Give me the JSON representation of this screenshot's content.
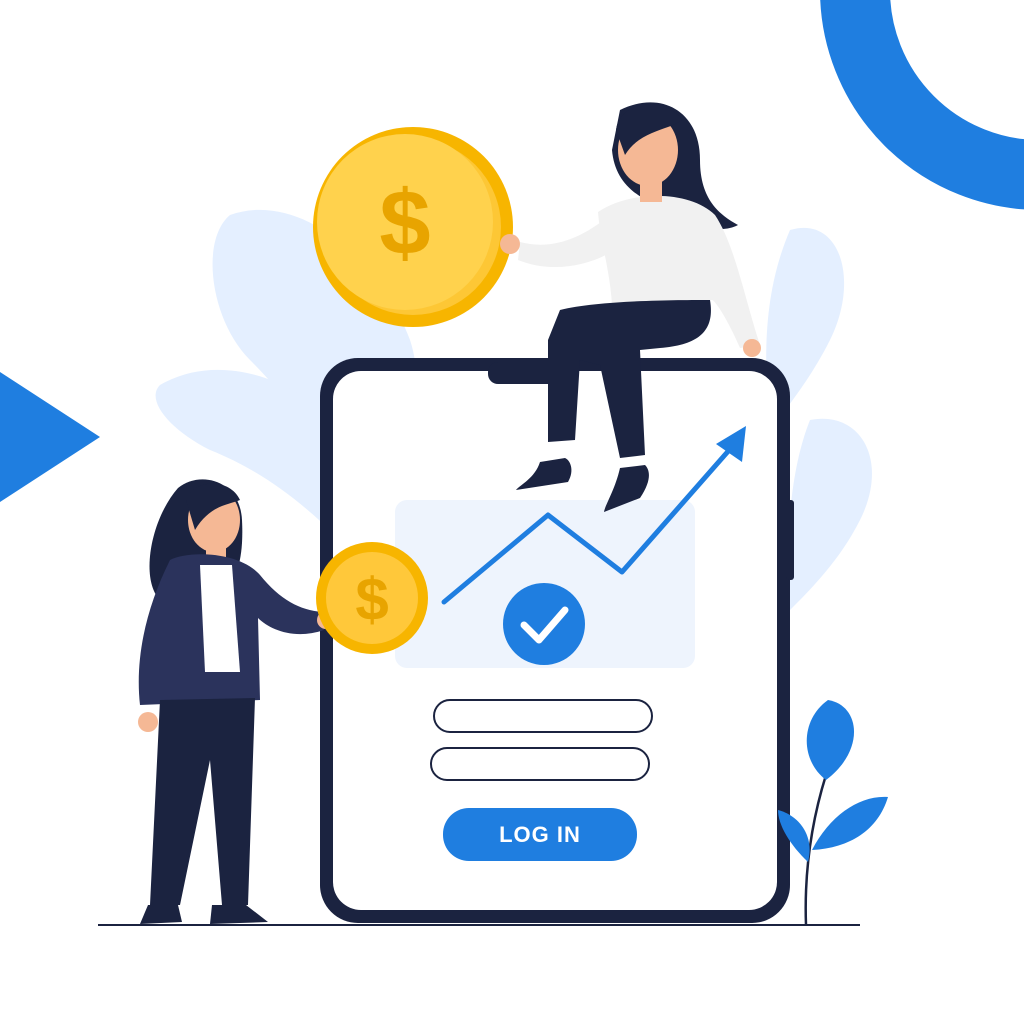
{
  "login_button": {
    "label": "LOG IN"
  },
  "form": {
    "username_value": "",
    "password_value": ""
  },
  "icons": {
    "large_coin": "dollar-coin-icon",
    "small_coin": "dollar-coin-icon",
    "check": "check-circle-icon",
    "trend": "trend-arrow-icon",
    "play": "play-triangle-icon"
  },
  "coin_symbol": "$",
  "colors": {
    "accent_blue": "#1f7ee0",
    "navy": "#1b2340",
    "coin_gold": "#f7b500",
    "leaf_light": "#e4efff"
  }
}
